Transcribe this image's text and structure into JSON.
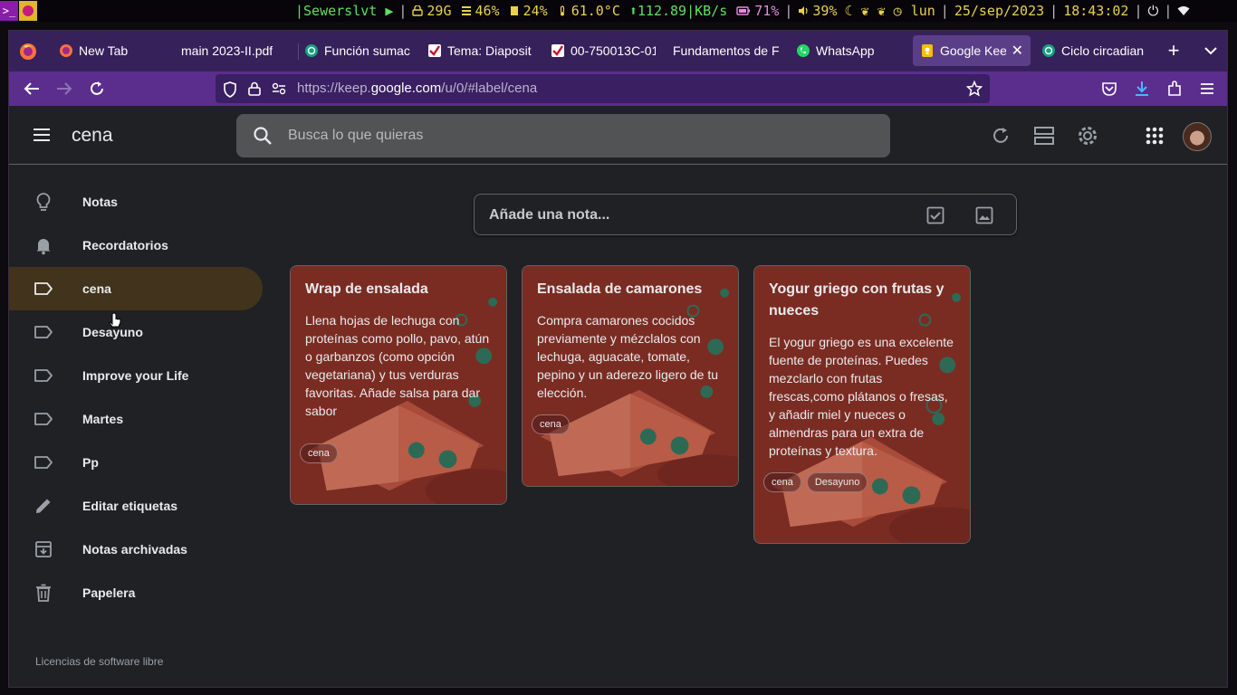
{
  "system_bar": {
    "workspace_label": ">_",
    "user": "|Sewerslvt ▶",
    "disk": "29G",
    "cpu": "46%",
    "mem": "24%",
    "temp": "61.0°C",
    "net": "112.89|KB/s",
    "battery": "71%",
    "volume": "39%",
    "day": "lun",
    "date": "25/sep/2023",
    "time": "18:43:02"
  },
  "browser": {
    "tabs": [
      {
        "label": "New Tab",
        "favicon": "firefox-icon"
      },
      {
        "label": "main 2023-II.pdf",
        "favicon": "pdf-icon"
      },
      {
        "label": "Función sumac",
        "favicon": "chatgpt-icon"
      },
      {
        "label": "Tema: Diaposit",
        "favicon": "checkmark-icon"
      },
      {
        "label": "00-750013C-01",
        "favicon": "checkmark-icon"
      },
      {
        "label": "Fundamentos de F",
        "favicon": "doc-icon"
      },
      {
        "label": "WhatsApp",
        "favicon": "whatsapp-icon"
      },
      {
        "label": "Google Keep",
        "favicon": "keep-icon",
        "active": true
      },
      {
        "label": "Ciclo circadian",
        "favicon": "chatgpt-icon"
      }
    ],
    "url_prefix": "https://keep.",
    "url_domain": "google.com",
    "url_suffix": "/u/0/#label/cena"
  },
  "app": {
    "title": "cena",
    "search_placeholder": "Busca lo que quieras",
    "take_note_placeholder": "Añade una nota...",
    "sidebar": [
      {
        "label": "Notas",
        "icon": "lightbulb-icon"
      },
      {
        "label": "Recordatorios",
        "icon": "bell-icon"
      },
      {
        "label": "cena",
        "icon": "label-icon",
        "active": true
      },
      {
        "label": "Desayuno",
        "icon": "label-icon"
      },
      {
        "label": "Improve your Life",
        "icon": "label-icon"
      },
      {
        "label": "Martes",
        "icon": "label-icon"
      },
      {
        "label": "Pp",
        "icon": "label-icon"
      },
      {
        "label": "Editar etiquetas",
        "icon": "pencil-icon"
      },
      {
        "label": "Notas archivadas",
        "icon": "archive-icon"
      },
      {
        "label": "Papelera",
        "icon": "trash-icon"
      }
    ],
    "footer_link": "Licencias de software libre",
    "notes": [
      {
        "title": "Wrap de ensalada",
        "text": "Llena hojas de lechuga con proteínas como pollo, pavo, atún o garbanzos (como opción vegetariana) y tus verduras favoritas. Añade salsa para dar sabor",
        "labels": [
          "cena"
        ]
      },
      {
        "title": "Ensalada de camarones",
        "text": "Compra camarones cocidos previamente y mézclalos con lechuga, aguacate, tomate, pepino y un aderezo ligero de tu elección.",
        "labels": [
          "cena"
        ]
      },
      {
        "title": "Yogur griego con frutas y nueces",
        "text": "El yogur griego es una excelente fuente de proteínas. Puedes mezclarlo con frutas frescas,como plátanos o fresas, y añadir miel y nueces o almendras para un extra de proteínas y textura.",
        "labels": [
          "cena",
          "Desayuno"
        ]
      }
    ]
  },
  "colors": {
    "tabbar": "#36215a",
    "navbar": "#5b2e8e",
    "app_bg": "#202124",
    "note_bg": "#77172e",
    "active_label_bg": "#41331c"
  }
}
